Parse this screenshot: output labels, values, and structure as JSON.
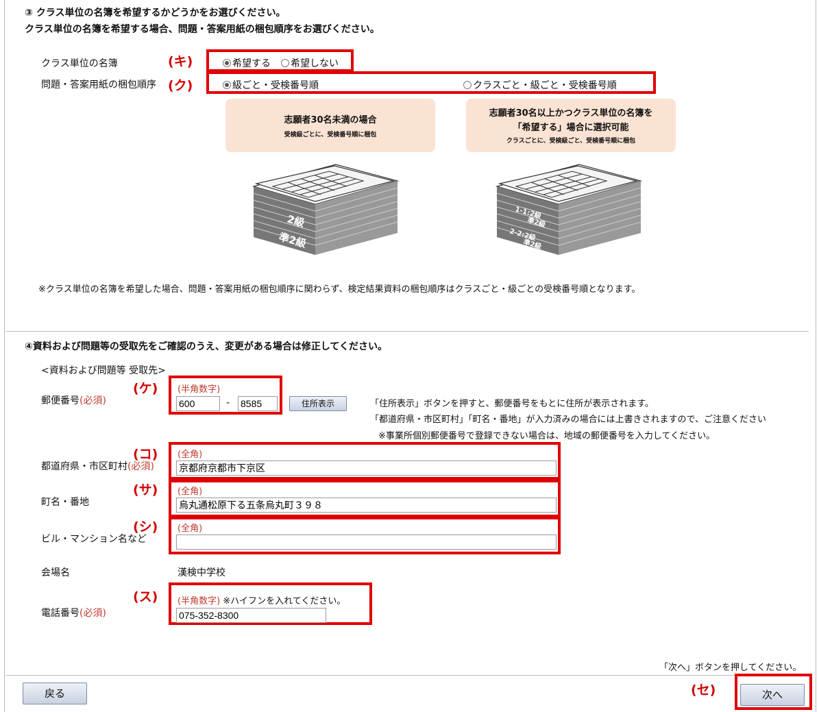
{
  "section3": {
    "heading1": "③ クラス単位の名簿を希望するかどうかをお選びください。",
    "heading2": "クラス単位の名簿を希望する場合、問題・答案用紙の梱包順序をお選びください。",
    "class_roster_label": "クラス単位の名簿",
    "class_roster_options": [
      "希望する",
      "希望しない"
    ],
    "packing_label": "問題・答案用紙の梱包順序",
    "packing_options": [
      "級ごと・受検番号順",
      "クラスごと・級ごと・受検番号順"
    ],
    "card1": {
      "title": "志願者30名未満の場合",
      "sub": "受検級ごとに、受検番号順に梱包"
    },
    "card2": {
      "title1": "志願者30名以上かつクラス単位の名簿を",
      "title2": "「希望する」場合に選択可能",
      "sub": "クラスごとに、受検級ごと、受検番号順に梱包"
    },
    "stack1_labels": [
      "2級",
      "準2級"
    ],
    "stack2_labels": [
      "1-1:2級",
      "準2級",
      "2-2:2級",
      "準2級"
    ],
    "note": "※クラス単位の名簿を希望した場合、問題・答案用紙の梱包順序に関わらず、検定結果資料の梱包順序はクラスごと・級ごとの受検番号順となります。"
  },
  "section4": {
    "heading": "④資料および問題等の受取先をご確認のうえ、変更がある場合は修正してください。",
    "subheading": "<資料および問題等 受取先>",
    "postal": {
      "label": "郵便番号",
      "required": "(必須)",
      "hint": "(半角数字)",
      "part1": "600",
      "dash": "-",
      "part2": "8585",
      "button": "住所表示",
      "help1": "「住所表示」ボタンを押すと、郵便番号をもとに住所が表示されます。",
      "help2": "「都道府県・市区町村」「町名・番地」が入力済みの場合には上書きされますので、ご注意ください",
      "help3": "※事業所個別郵便番号で登録できない場合は、地域の郵便番号を入力してください。"
    },
    "prefecture": {
      "label": "都道府県・市区町村",
      "required": "(必須)",
      "hint": "(全角)",
      "value": "京都府京都市下京区"
    },
    "town": {
      "label": "町名・番地",
      "hint": "(全角)",
      "value": "烏丸通松原下る五条烏丸町３９８"
    },
    "building": {
      "label": "ビル・マンション名など",
      "hint": "(全角)",
      "value": ""
    },
    "venue": {
      "label": "会場名",
      "value": "漢検中学校"
    },
    "phone": {
      "label": "電話番号",
      "required": "(必須)",
      "hint": "(半角数字)",
      "hint2": " ※ハイフンを入れてください。",
      "value": "075-352-8300"
    }
  },
  "footer": {
    "next_hint": "「次へ」ボタンを押してください。",
    "back_button": "戻る",
    "next_button": "次へ"
  },
  "annotations": [
    "(キ)",
    "(ク)",
    "(ケ)",
    "(コ)",
    "(サ)",
    "(シ)",
    "(ス)",
    "(セ)"
  ],
  "colors": {
    "annotation": "#e00000",
    "required": "#c0392b",
    "card": "#fbe3d3"
  }
}
